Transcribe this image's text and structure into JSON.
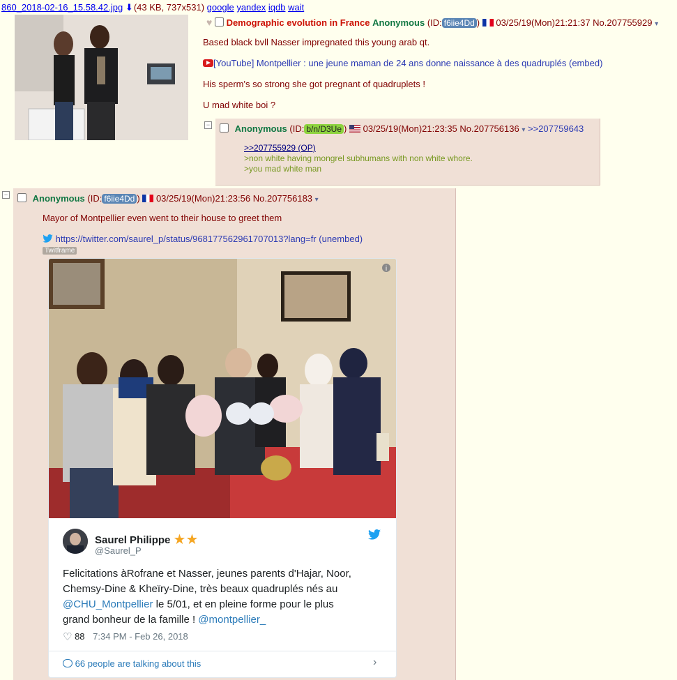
{
  "file": {
    "name": "860_2018-02-16_15.58.42.jpg",
    "info": "(43 KB, 737x531)",
    "links": [
      "google",
      "yandex",
      "iqdb",
      "wait"
    ]
  },
  "op": {
    "subject": "Demographic evolution in France",
    "name": "Anonymous",
    "id_label": "(ID:",
    "id": "f6iie4Dd",
    "id_close": ")",
    "datetime": "03/25/19(Mon)21:21:37",
    "postno": "No.207755929",
    "lines": [
      "Based black bvll Nasser impregnated this young arab qt.",
      "[YouTube] Montpellier : une jeune maman de 24 ans donne naissance à des quadruplés (embed)",
      "His sperm's so strong she got pregnant of quadruplets !",
      "U mad white boi ?"
    ]
  },
  "reply1": {
    "name": "Anonymous",
    "id_label": "(ID:",
    "id": "b/n/D3Ue",
    "id_close": ")",
    "datetime": "03/25/19(Mon)21:23:35",
    "postno": "No.207756136",
    "backlink": ">>207759643",
    "quote": ">>207755929 (OP)",
    "green1": ">non white having mongrel subhumans with non white whore.",
    "green2": ">you mad white man"
  },
  "reply2": {
    "name": "Anonymous",
    "id_label": "(ID:",
    "id": "f6iie4Dd",
    "id_close": ")",
    "datetime": "03/25/19(Mon)21:23:56",
    "postno": "No.207756183",
    "text": "Mayor of Montpellier even went to their house to greet them",
    "url": "https://twitter.com/saurel_p/status/968177562961707013?lang=fr",
    "unembed": "(unembed)",
    "twitframe": "Twitframe"
  },
  "tweet": {
    "name": "Saurel Philippe",
    "handle": "@Saurel_P",
    "text_line1": "Felicitations àRofrane et Nasser, jeunes parents d'Hajar, Noor,",
    "text_line2": "Chemsy-Dine & Kheïry-Dine, très beaux quadruplés nés au",
    "mention1": "@CHU_Montpellier",
    "text_line3b": " le 5/01, et en pleine forme pour le plus",
    "text_line4": "grand bonheur de la famille ! ",
    "mention2": "@montpellier_",
    "likes": "88",
    "time": "7:34 PM - Feb 26, 2018",
    "talk": "66 people are talking about this"
  },
  "colors": {
    "bg": "#ffffee",
    "post_bg": "#f0e0d6",
    "subject": "#cc1105",
    "name": "#117743",
    "greentext": "#789922",
    "twitter_blue": "#1da1f2"
  }
}
